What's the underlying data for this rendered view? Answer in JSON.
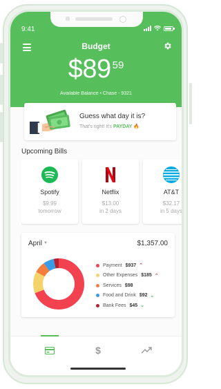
{
  "status_bar": {
    "time": "9:41"
  },
  "header": {
    "title": "Budget",
    "balance_main": "$89",
    "balance_cents": "59",
    "balance_caption": "Available Balance • Chase - 9321",
    "accent_color": "#56bf5b"
  },
  "payday": {
    "title": "Guess what day it is?",
    "message_prefix": "That's right! It's",
    "message_highlight": "PAYDAY",
    "emoji": "🔥"
  },
  "bills_section": {
    "title": "Upcoming Bills",
    "items": [
      {
        "name": "Spotify",
        "amount": "$9.99",
        "due": "tomorrow",
        "icon": "spotify-icon"
      },
      {
        "name": "Netflix",
        "amount": "$13.00",
        "due": "in 2 days",
        "icon": "netflix-icon"
      },
      {
        "name": "AT&T",
        "amount": "$32.17",
        "due": "in 5 days",
        "icon": "att-icon"
      }
    ]
  },
  "spending": {
    "month": "April",
    "total": "$1,357.00",
    "categories": [
      {
        "label": "Payment",
        "amount": "$937",
        "color": "#f2414f",
        "trend": "up"
      },
      {
        "label": "Other Expenses",
        "amount": "$185",
        "color": "#f5d36b",
        "trend": "up"
      },
      {
        "label": "Services",
        "amount": "$98",
        "color": "#f47c3c",
        "trend": "none"
      },
      {
        "label": "Food and Drink",
        "amount": "$92",
        "color": "#3a9be6",
        "trend": "down"
      },
      {
        "label": "Bank Fees",
        "amount": "$45",
        "color": "#b5222f",
        "trend": "down"
      }
    ]
  },
  "bottom_nav": {
    "items": [
      {
        "icon": "card-icon",
        "active": true
      },
      {
        "icon": "dollar-icon",
        "active": false
      },
      {
        "icon": "trend-icon",
        "active": false
      }
    ]
  }
}
